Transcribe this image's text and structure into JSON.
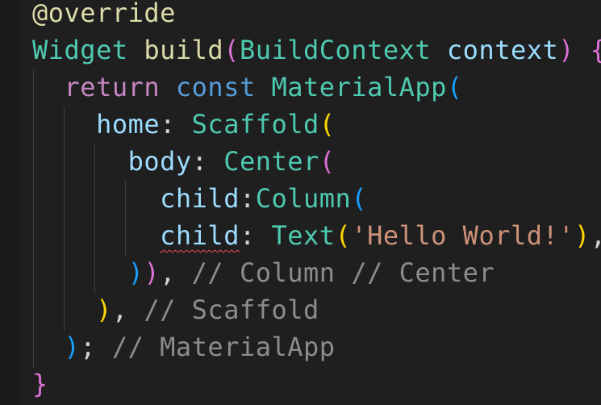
{
  "editor": {
    "lines": {
      "l1": {
        "decorator": "@override"
      },
      "l2": {
        "type_widget": "Widget",
        "fn_build": "build",
        "open_paren": "(",
        "type_ctx": "BuildContext",
        "param_ctx": "context",
        "close_paren": ")",
        "open_brace": "{"
      },
      "l3": {
        "kw_return": "return",
        "kw_const": "const",
        "type_app": "MaterialApp",
        "open_paren": "("
      },
      "l4": {
        "prop_home": "home",
        "colon": ":",
        "type_scaffold": "Scaffold",
        "open_paren": "("
      },
      "l5": {
        "prop_body": "body",
        "colon": ":",
        "type_center": "Center",
        "open_paren": "("
      },
      "l6": {
        "prop_child": "child",
        "colon": ":",
        "type_column": "Column",
        "open_paren": "("
      },
      "l7": {
        "prop_child": "child",
        "colon": ":",
        "type_text": "Text",
        "open_paren": "(",
        "str_hello": "'Hello World!'",
        "close_paren": ")",
        "comma": ","
      },
      "l8": {
        "close_paren_col": ")",
        "close_paren_center": ")",
        "comma": ",",
        "comment": "// Column // Center"
      },
      "l9": {
        "close_paren": ")",
        "comma": ",",
        "comment": "// Scaffold"
      },
      "l10": {
        "close_paren": ")",
        "semicolon": ";",
        "comment": "// MaterialApp"
      },
      "l11": {
        "close_brace": "}"
      }
    },
    "colors": {
      "background": "#1f1f1f",
      "decorator": "#dcdcaa",
      "type": "#4ec9b0",
      "function": "#dcdcaa",
      "parameter": "#9cdcfe",
      "control_keyword": "#c586c0",
      "keyword": "#569cd6",
      "string": "#ce9178",
      "comment": "#8c8c8c",
      "bracket_level1": "#ffd700",
      "bracket_level2": "#da70d6",
      "bracket_level3": "#179fff",
      "error_squiggle": "#f14c4c"
    }
  }
}
